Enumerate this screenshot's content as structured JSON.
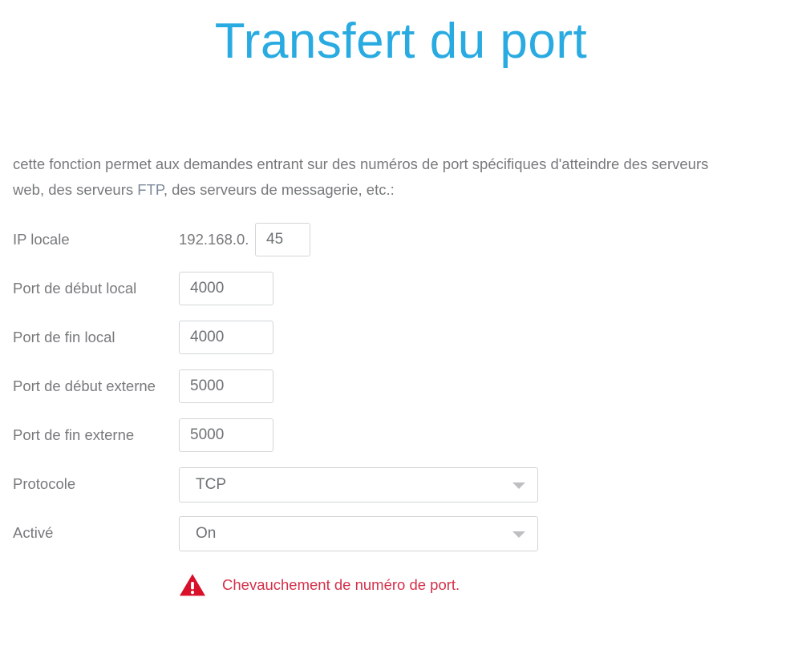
{
  "page": {
    "title": "Transfert du port",
    "title_color": "#29abe2",
    "intro_before_ftp": "cette fonction permet aux demandes entrant sur des numéros de port spécifiques d'atteindre des serveurs web, des serveurs ",
    "intro_ftp": "FTP",
    "intro_after_ftp": ", des serveurs de messagerie, etc.:"
  },
  "form": {
    "rows": [
      {
        "label": "IP locale",
        "type": "ip",
        "prefix": "192.168.0.",
        "value": "45",
        "placeholder": ""
      },
      {
        "label": "Port de début local",
        "type": "text",
        "value": "4000",
        "placeholder": ""
      },
      {
        "label": "Port de fin local",
        "type": "text",
        "value": "4000",
        "placeholder": ""
      },
      {
        "label": "Port de début externe",
        "type": "text",
        "value": "5000",
        "placeholder": ""
      },
      {
        "label": "Port de fin externe",
        "type": "text",
        "value": "5000",
        "placeholder": ""
      },
      {
        "label": "Protocole",
        "type": "select",
        "value": "TCP",
        "icon": "chevron-down-icon"
      },
      {
        "label": "Activé",
        "type": "select",
        "value": "On",
        "icon": "chevron-down-icon"
      }
    ]
  },
  "error": {
    "icon": "warning-triangle-icon",
    "icon_color": "#d9102a",
    "text": "Chevauchement de numéro de port.",
    "text_color": "#d4304a"
  }
}
